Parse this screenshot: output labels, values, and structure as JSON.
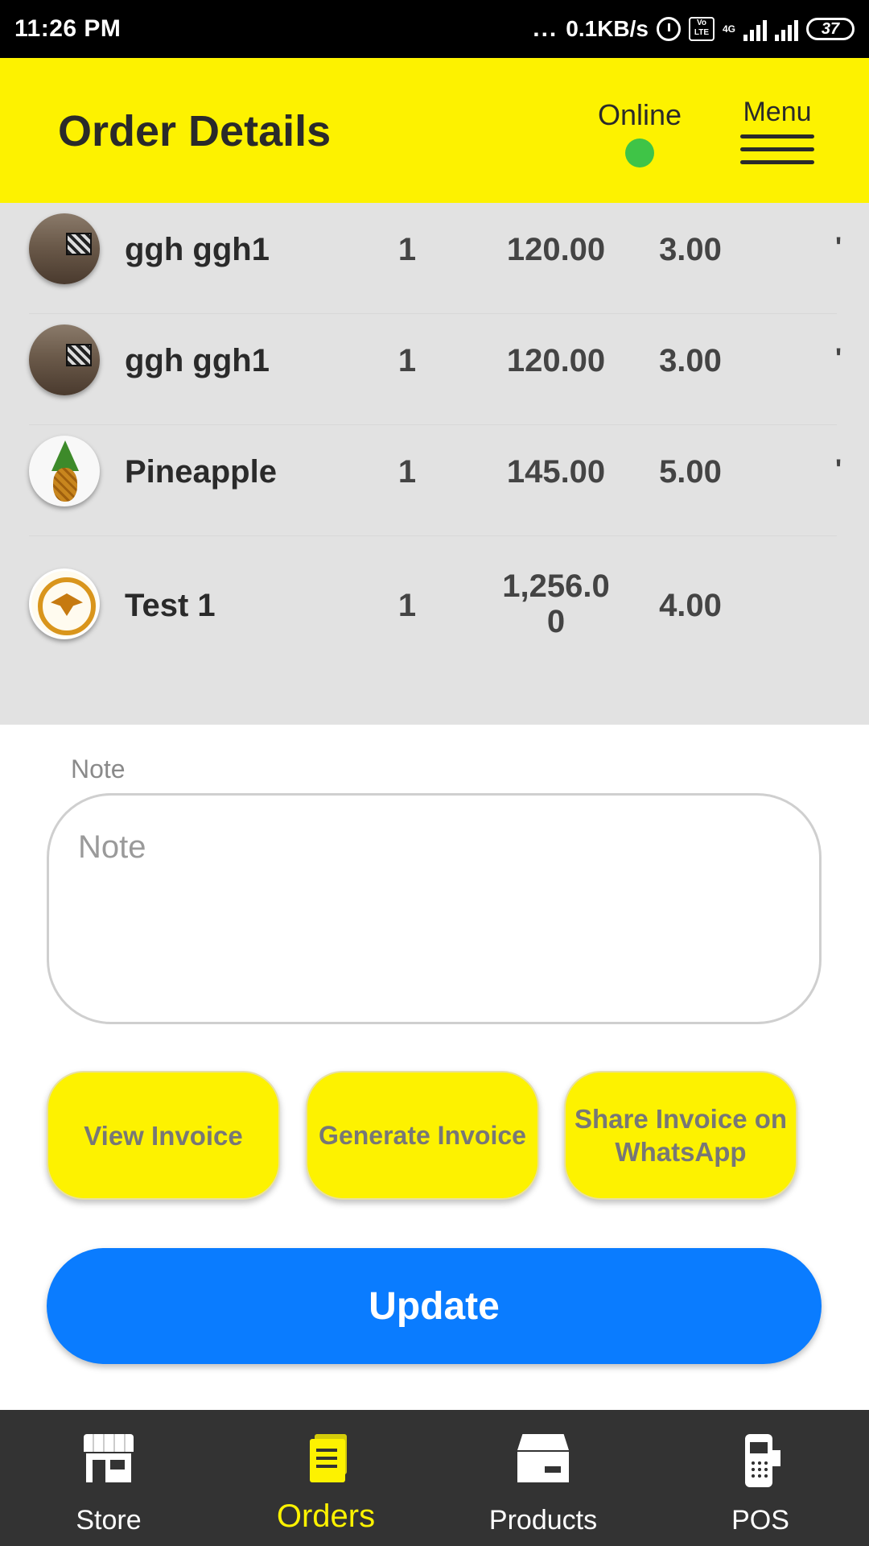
{
  "status_bar": {
    "time": "11:26 PM",
    "dots": "...",
    "net_speed": "0.1KB/s",
    "volte": "Vo LTE",
    "network": "4G",
    "battery": "37"
  },
  "header": {
    "title": "Order Details",
    "online_label": "Online",
    "menu_label": "Menu",
    "online_color": "#3fc447",
    "brand_color": "#fdf200"
  },
  "items": [
    {
      "name": "ggh ggh1",
      "qty": "1",
      "price": "120.00",
      "tax": "3.00",
      "edge": "'",
      "image": "room-photo"
    },
    {
      "name": "ggh ggh1",
      "qty": "1",
      "price": "120.00",
      "tax": "3.00",
      "edge": "'",
      "image": "room-photo"
    },
    {
      "name": "Pineapple",
      "qty": "1",
      "price": "145.00",
      "tax": "5.00",
      "edge": "'",
      "image": "pineapple-photo"
    },
    {
      "name": "Test 1",
      "qty": "1",
      "price": "1,256.00",
      "tax": "4.00",
      "edge": "",
      "image": "mockingjay-emblem"
    }
  ],
  "note": {
    "label": "Note",
    "placeholder": "Note",
    "value": ""
  },
  "actions": {
    "view_invoice": "View Invoice",
    "generate_invoice": "Generate Invoice",
    "share_invoice": "Share Invoice on WhatsApp",
    "update": "Update",
    "update_color": "#0a7cff"
  },
  "bottom_nav": [
    {
      "label": "Store",
      "icon": "store-icon",
      "active": false
    },
    {
      "label": "Orders",
      "icon": "orders-icon",
      "active": true
    },
    {
      "label": "Products",
      "icon": "products-icon",
      "active": false
    },
    {
      "label": "POS",
      "icon": "pos-icon",
      "active": false
    }
  ]
}
